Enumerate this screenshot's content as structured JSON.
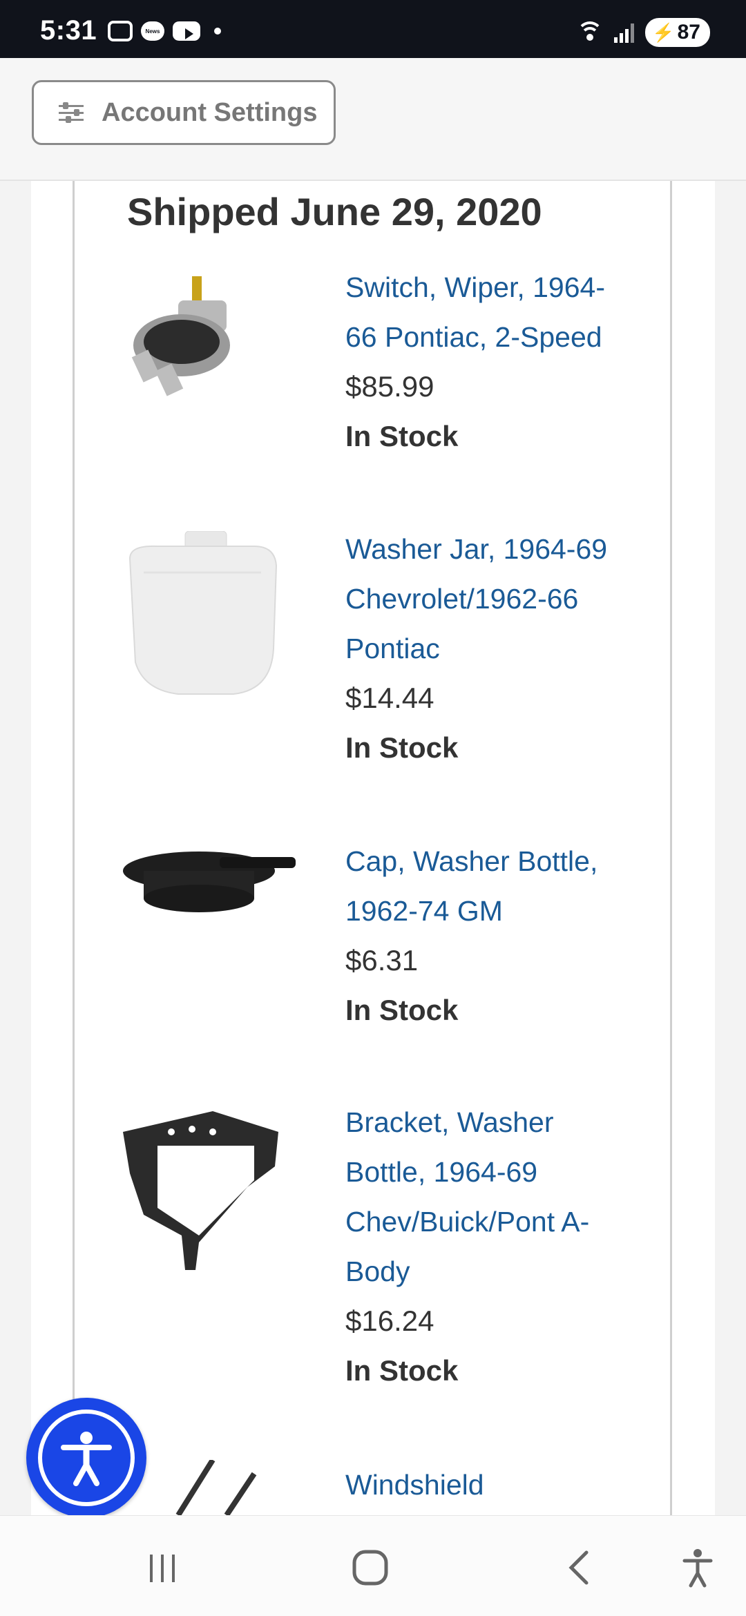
{
  "status_bar": {
    "time": "5:31",
    "battery": "87",
    "news_badge": "News"
  },
  "header": {
    "account_settings_label": "Account Settings"
  },
  "order": {
    "shipped_heading": "Shipped June 29, 2020",
    "items": [
      {
        "name": "Switch, Wiper, 1964-66 Pontiac, 2-Speed",
        "price": "$85.99",
        "stock": "In Stock",
        "icon": "wiper-switch-image"
      },
      {
        "name": "Washer Jar, 1964-69 Chevrolet/1962-66 Pontiac",
        "price": "$14.44",
        "stock": "In Stock",
        "icon": "washer-jar-image"
      },
      {
        "name": "Cap, Washer Bottle, 1962-74 GM",
        "price": "$6.31",
        "stock": "In Stock",
        "icon": "washer-cap-image"
      },
      {
        "name": "Bracket, Washer Bottle, 1964-69 Chev/Buick/Pont A-Body",
        "price": "$16.24",
        "stock": "In Stock",
        "icon": "washer-bracket-image"
      },
      {
        "name": "Windshield",
        "price": "",
        "stock": "",
        "icon": "wiper-arms-image"
      }
    ]
  },
  "colors": {
    "link": "#1a5a96",
    "accessibility_button": "#1a46e6",
    "status_bar": "#10131b"
  }
}
